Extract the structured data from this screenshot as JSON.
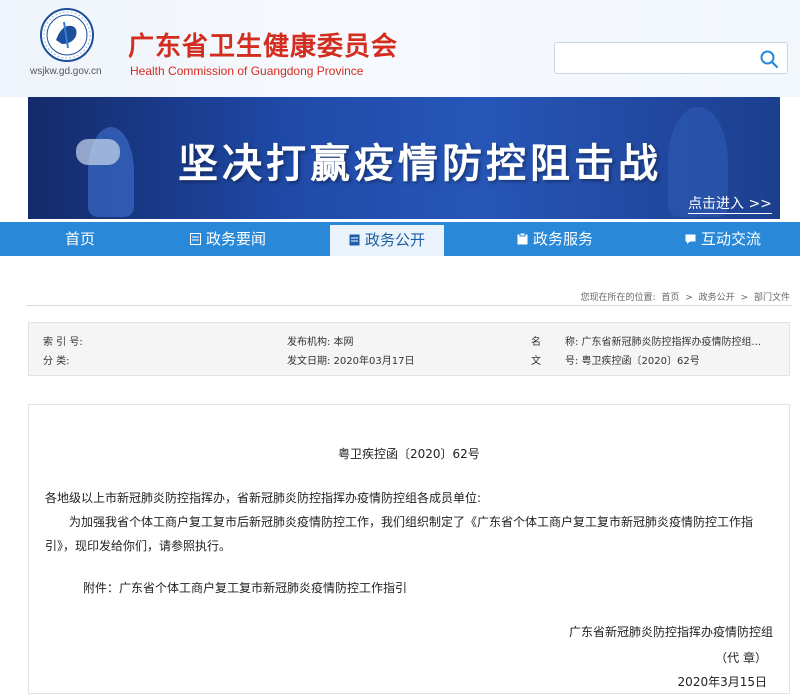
{
  "header": {
    "domain": "wsjkw.gd.gov.cn",
    "org_name_cn": "广东省卫生健康委员会",
    "org_name_en": "Health Commission of Guangdong Province",
    "search": {
      "value": "",
      "placeholder": ""
    },
    "colors": {
      "brand_red": "#d22d1f",
      "nav_blue": "#2989d8"
    }
  },
  "banner": {
    "title": "坚决打赢疫情防控阻击战",
    "enter_link": "点击进入 >>"
  },
  "nav": {
    "items": [
      {
        "label": "首页",
        "icon": ""
      },
      {
        "label": "政务要闻",
        "icon": "news-icon"
      },
      {
        "label": "政务公开",
        "icon": "document-icon",
        "active": true
      },
      {
        "label": "政务服务",
        "icon": "service-icon"
      },
      {
        "label": "互动交流",
        "icon": "chat-icon"
      }
    ]
  },
  "breadcrumb": {
    "prefix": "您现在所在的位置:",
    "items": [
      "首页",
      "政务公开",
      "部门文件"
    ],
    "separator": ">"
  },
  "meta": {
    "index_label": "索 引 号:",
    "category_label": "分 类:",
    "publisher": "发布机构: 本网",
    "issue_date": "发文日期: 2020年03月17日",
    "name_label": "名",
    "name_value": "称: 广东省新冠肺炎防控指挥办疫情防控组...",
    "doc_label": "文",
    "doc_value": "号: 粤卫疾控函〔2020〕62号"
  },
  "document": {
    "doc_number": "粤卫疾控函〔2020〕62号",
    "salutation": "各地级以上市新冠肺炎防控指挥办，省新冠肺炎防控指挥办疫情防控组各成员单位:",
    "body_line1": "为加强我省个体工商户复工复市后新冠肺炎疫情防控工作，我们组织制定了《广东省个体工商户复工复市新冠肺炎疫情防控工作指",
    "body_line2": "引》，现印发给你们，请参照执行。",
    "attachment": "附件：广东省个体工商户复工复市新冠肺炎疫情防控工作指引",
    "signature_org": "广东省新冠肺炎防控指挥办疫情防控组",
    "seal_note": "（代 章）",
    "sign_date": "2020年3月15日"
  }
}
